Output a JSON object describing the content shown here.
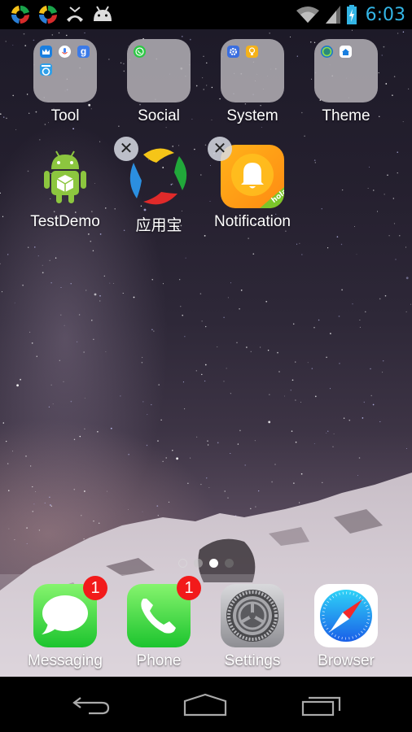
{
  "status_bar": {
    "notification_icons": [
      "app-store-icon",
      "app-store-icon",
      "missed-call-icon",
      "android-debug-icon"
    ],
    "system_icons": [
      "wifi-icon",
      "signal-icon",
      "battery-charging-icon"
    ],
    "clock": "6:03",
    "clock_color": "#33b5e5"
  },
  "home": {
    "folders": [
      {
        "label": "Tool",
        "apps": [
          "crown-app-icon",
          "voice-search-icon",
          "google-icon",
          "browser-speed-icon"
        ]
      },
      {
        "label": "Social",
        "apps": [
          "whatsapp-icon"
        ]
      },
      {
        "label": "System",
        "apps": [
          "settings-gear-icon",
          "bulb-icon"
        ]
      },
      {
        "label": "Theme",
        "apps": [
          "ring-theme-icon",
          "home-launcher-icon"
        ]
      }
    ],
    "apps": [
      {
        "label": "TestDemo",
        "icon": "android-robot-icon",
        "removable": false
      },
      {
        "label": "应用宝",
        "icon": "yingyongbao-icon",
        "removable": true
      },
      {
        "label": "Notification",
        "icon": "bell-notification-icon",
        "removable": true,
        "corner_text": "hola"
      }
    ],
    "remove_glyph": "✕",
    "page_indicator": {
      "pages": 4,
      "current": 3,
      "first_is_search": true
    }
  },
  "dock": {
    "apps": [
      {
        "label": "Messaging",
        "icon": "message-bubble-icon",
        "badge": "1"
      },
      {
        "label": "Phone",
        "icon": "phone-handset-icon",
        "badge": "1"
      },
      {
        "label": "Settings",
        "icon": "settings-gear-icon",
        "badge": null
      },
      {
        "label": "Browser",
        "icon": "compass-icon",
        "badge": null
      }
    ],
    "badge_color": "#f21a1a"
  },
  "nav_bar": {
    "buttons": [
      "back",
      "home",
      "recents"
    ]
  }
}
